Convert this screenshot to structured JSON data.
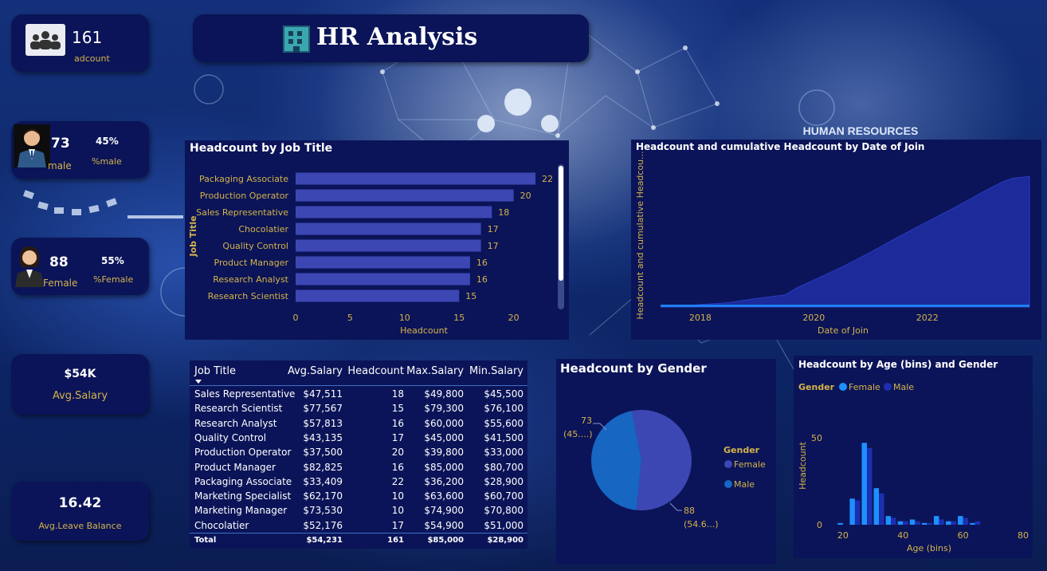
{
  "title": "HR Analysis",
  "background_text": "HUMAN RESOURCES",
  "kpis": {
    "headcount": {
      "value": "161",
      "label": "adcount"
    },
    "male": {
      "value": "73",
      "label": "male",
      "pct": "45%",
      "pct_label": "%male"
    },
    "female": {
      "value": "88",
      "label": "Female",
      "pct": "55%",
      "pct_label": "%Female"
    },
    "avg_salary": {
      "value": "$54K",
      "label": "Avg.Salary"
    },
    "avg_leave": {
      "value": "16.42",
      "label": "Avg.Leave Balance"
    }
  },
  "colors": {
    "bar": "#3d47b3",
    "area": "#1c2a9a",
    "line": "#1e7ef0",
    "female": "#3d47b3",
    "male": "#1666c2",
    "age_female": "#1e90ff",
    "age_male": "#1c2fb0",
    "gold": "#d4b34a"
  },
  "chart_data": [
    {
      "id": "job_title",
      "type": "bar",
      "orientation": "horizontal",
      "title": "Headcount by Job Title",
      "xlabel": "Headcount",
      "ylabel": "Job Title",
      "categories": [
        "Packaging Associate",
        "Production Operator",
        "Sales Representative",
        "Chocolatier",
        "Quality Control",
        "Product Manager",
        "Research Analyst",
        "Research Scientist"
      ],
      "values": [
        22,
        20,
        18,
        17,
        17,
        16,
        16,
        15
      ],
      "xticks": [
        0,
        5,
        10,
        15,
        20
      ],
      "xlim": [
        0,
        22
      ],
      "grid": false
    },
    {
      "id": "date_of_join",
      "type": "area",
      "title": "Headcount and cumulative Headcount by Date of Join",
      "xlabel": "Date of Join",
      "ylabel": "Headcount and cumulative Headcou...",
      "xticks": [
        "2018",
        "2020",
        "2022"
      ],
      "xlim": [
        2017.3,
        2023.8
      ],
      "series": [
        {
          "type": "area",
          "x": [
            2017.3,
            2017.8,
            2018.5,
            2019.0,
            2019.5,
            2019.7,
            2020.0,
            2020.5,
            2021.0,
            2021.5,
            2022.0,
            2022.5,
            2023.0,
            2023.3,
            2023.5,
            2023.8
          ],
          "y": [
            0,
            2,
            5,
            10,
            14,
            22,
            31,
            46,
            63,
            81,
            98,
            115,
            133,
            143,
            148,
            150
          ]
        },
        {
          "type": "line",
          "x": [
            2017.3,
            2023.8
          ],
          "y": [
            0.5,
            0.5
          ]
        }
      ],
      "ylim": [
        0,
        165
      ]
    },
    {
      "id": "gender",
      "type": "pie",
      "title": "Headcount by Gender",
      "legend_title": "Gender",
      "legend_position": "right",
      "slices": [
        {
          "label": "Female",
          "value": 88,
          "text": "88",
          "pct_text": "(54.6...)"
        },
        {
          "label": "Male",
          "value": 73,
          "text": "73",
          "pct_text": "(45....)"
        }
      ]
    },
    {
      "id": "age_gender",
      "type": "bar",
      "title": "Headcount by Age (bins) and Gender",
      "legend_title": "Gender",
      "legend_position": "top-left",
      "xlabel": "Age (bins)",
      "ylabel": "Headcount",
      "xticks": [
        20,
        40,
        60,
        80
      ],
      "yticks": [
        0,
        50
      ],
      "xlim": [
        15,
        80
      ],
      "ylim": [
        0,
        65
      ],
      "series": [
        {
          "name": "Female",
          "x": [
            20,
            24,
            28,
            32,
            36,
            40,
            44,
            48,
            52,
            56,
            60,
            64
          ],
          "values": [
            1,
            15,
            47,
            21,
            5,
            2,
            3,
            1,
            5,
            2,
            5,
            1
          ]
        },
        {
          "name": "Male",
          "x": [
            20,
            24,
            28,
            32,
            36,
            40,
            44,
            48,
            52,
            56,
            60,
            64
          ],
          "values": [
            0,
            14,
            44,
            18,
            4,
            2,
            2,
            1,
            3,
            2,
            4,
            2
          ]
        }
      ]
    }
  ],
  "table": {
    "columns": [
      "Job Title",
      "Avg.Salary",
      "Headcount",
      "Max.Salary",
      "Min.Salary"
    ],
    "rows": [
      [
        "Sales Representative",
        "$47,511",
        "18",
        "$49,800",
        "$45,500"
      ],
      [
        "Research Scientist",
        "$77,567",
        "15",
        "$79,300",
        "$76,100"
      ],
      [
        "Research Analyst",
        "$57,813",
        "16",
        "$60,000",
        "$55,600"
      ],
      [
        "Quality Control",
        "$43,135",
        "17",
        "$45,000",
        "$41,500"
      ],
      [
        "Production Operator",
        "$37,500",
        "20",
        "$39,800",
        "$33,000"
      ],
      [
        "Product Manager",
        "$82,825",
        "16",
        "$85,000",
        "$80,700"
      ],
      [
        "Packaging Associate",
        "$33,409",
        "22",
        "$36,200",
        "$28,900"
      ],
      [
        "Marketing Specialist",
        "$62,170",
        "10",
        "$63,600",
        "$60,700"
      ],
      [
        "Marketing Manager",
        "$73,530",
        "10",
        "$74,900",
        "$70,800"
      ],
      [
        "Chocolatier",
        "$52,176",
        "17",
        "$54,900",
        "$51,000"
      ]
    ],
    "total": [
      "Total",
      "$54,231",
      "161",
      "$85,000",
      "$28,900"
    ]
  }
}
